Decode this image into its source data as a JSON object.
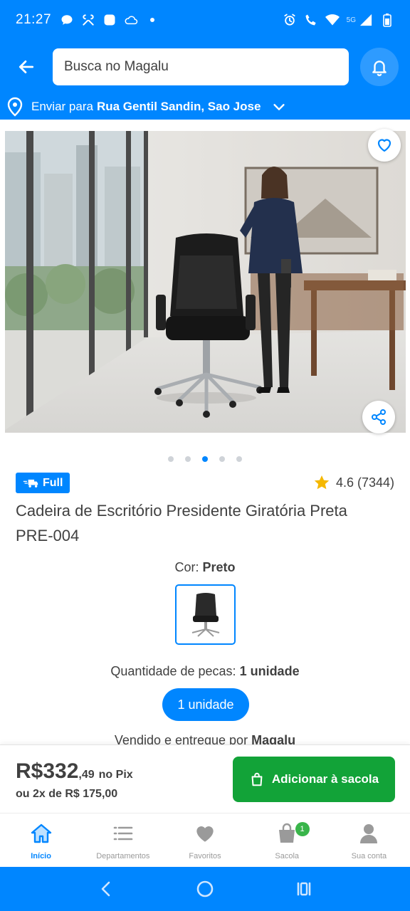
{
  "status_bar": {
    "time": "21:27",
    "network": "5G"
  },
  "header": {
    "search_placeholder": "Busca no Magalu"
  },
  "address": {
    "prefix": "Enviar para",
    "street": "Rua Gentil Sandin, Sao Jose"
  },
  "gallery": {
    "image_count": 5,
    "active_index": 2
  },
  "product": {
    "badge": "Full",
    "rating": "4.6 (7344)",
    "title": "Cadeira de Escritório Presidente Giratória Preta PRE-004",
    "color_label": "Cor:",
    "color_value": "Preto",
    "quantity_label": "Quantidade de pecas:",
    "quantity_value": "1 unidade",
    "quantity_button": "1 unidade",
    "seller_prefix": "Vendido e entregue por",
    "seller_name": "Magalu"
  },
  "price": {
    "integer": "R$332",
    "cents": ",49",
    "pix": "no Pix",
    "installments": "ou 2x de R$ 175,00",
    "add_to_bag": "Adicionar à sacola"
  },
  "bottom_nav": {
    "items": [
      {
        "label": "Início",
        "icon": "home-icon",
        "active": true
      },
      {
        "label": "Departamentos",
        "icon": "list-icon",
        "active": false
      },
      {
        "label": "Favoritos",
        "icon": "heart-icon",
        "active": false
      },
      {
        "label": "Sacola",
        "icon": "bag-icon",
        "active": false,
        "badge": "1"
      },
      {
        "label": "Sua conta",
        "icon": "user-icon",
        "active": false
      }
    ]
  },
  "colors": {
    "brand_blue": "#0086ff",
    "buy_green": "#12a338",
    "text": "#404040"
  }
}
